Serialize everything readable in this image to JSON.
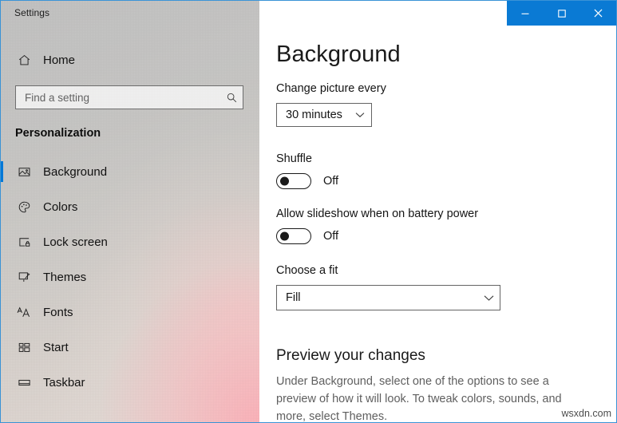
{
  "window": {
    "title": "Settings",
    "accent_color": "#0078d7",
    "titlebar_color": "#0a7ad4",
    "controls": [
      {
        "name": "minimize",
        "glyph": "minimize-icon"
      },
      {
        "name": "maximize",
        "glyph": "maximize-icon"
      },
      {
        "name": "close",
        "glyph": "close-icon"
      }
    ]
  },
  "sidebar": {
    "home_label": "Home",
    "home_icon": "home-icon",
    "search": {
      "placeholder": "Find a setting",
      "value": "",
      "icon": "search-icon"
    },
    "section_title": "Personalization",
    "items": [
      {
        "label": "Background",
        "icon": "picture-icon",
        "selected": true
      },
      {
        "label": "Colors",
        "icon": "palette-icon",
        "selected": false
      },
      {
        "label": "Lock screen",
        "icon": "lock-screen-icon",
        "selected": false
      },
      {
        "label": "Themes",
        "icon": "brush-icon",
        "selected": false
      },
      {
        "label": "Fonts",
        "icon": "fonts-icon",
        "selected": false
      },
      {
        "label": "Start",
        "icon": "start-tiles-icon",
        "selected": false
      },
      {
        "label": "Taskbar",
        "icon": "taskbar-icon",
        "selected": false
      }
    ]
  },
  "main": {
    "page_title": "Background",
    "change_picture": {
      "label": "Change picture every",
      "value": "30 minutes"
    },
    "shuffle": {
      "label": "Shuffle",
      "state": "Off",
      "on": false
    },
    "battery_slideshow": {
      "label": "Allow slideshow when on battery power",
      "state": "Off",
      "on": false
    },
    "choose_fit": {
      "label": "Choose a fit",
      "value": "Fill"
    },
    "preview": {
      "heading": "Preview your changes",
      "description": "Under Background, select one of the options to see a preview of how it will look. To tweak colors, sounds, and more, select Themes."
    }
  },
  "watermark": "wsxdn.com"
}
